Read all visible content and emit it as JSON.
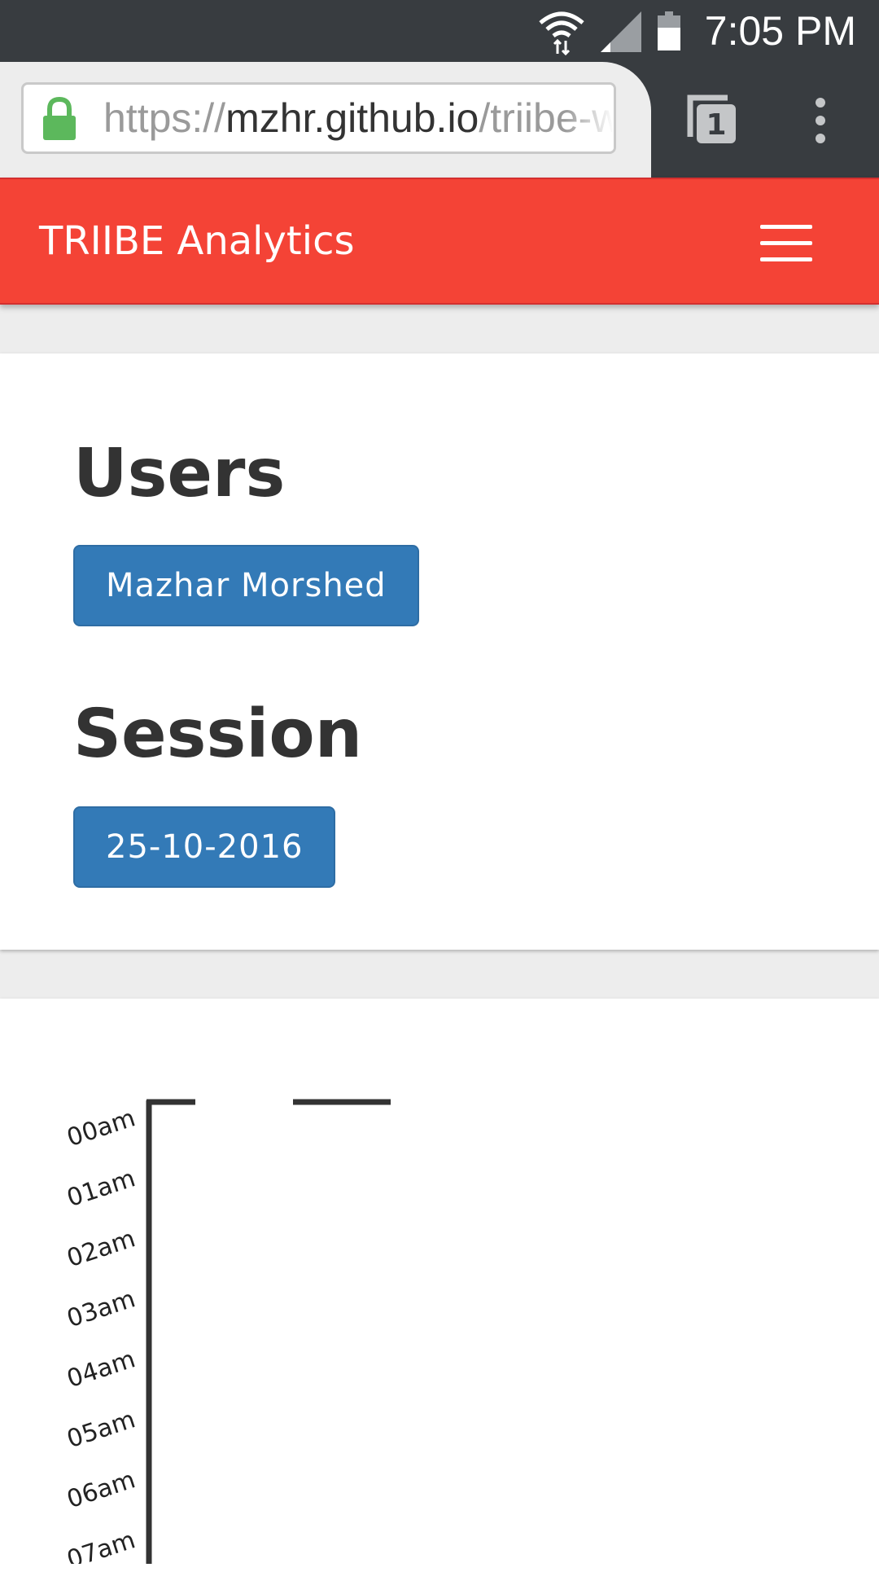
{
  "status_bar": {
    "time": "7:05 PM",
    "icons": [
      "wifi-icon",
      "signal-icon",
      "battery-icon"
    ]
  },
  "browser": {
    "url_scheme": "https://",
    "url_domain": "mzhr.github.io",
    "url_path": "/triibe-w",
    "tab_count": "1",
    "icons": [
      "lock-icon",
      "tabs-icon",
      "overflow-menu-icon"
    ]
  },
  "navbar": {
    "brand": "TRIIBE Analytics",
    "color": "#f44336",
    "menu_icon": "hamburger-icon"
  },
  "main": {
    "users_heading": "Users",
    "user_button": "Mazhar Morshed",
    "session_heading": "Session",
    "session_button": "25-10-2016",
    "button_color": "#337ab7"
  },
  "chart_data": {
    "type": "bar",
    "orientation": "horizontal",
    "y_ticks": [
      "00am",
      "01am",
      "02am",
      "03am",
      "04am",
      "05am",
      "06am",
      "07am"
    ],
    "visible_marks": [
      "top-axis-segment-1",
      "top-axis-segment-2"
    ]
  }
}
